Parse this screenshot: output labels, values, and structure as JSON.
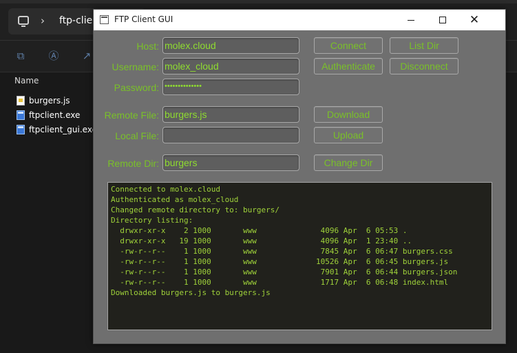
{
  "explorer": {
    "address_text": "ftp-clien",
    "column_name": "Name",
    "files": [
      {
        "name": "burgers.js",
        "type": "js"
      },
      {
        "name": "ftpclient.exe",
        "type": "exe"
      },
      {
        "name": "ftpclient_gui.exe",
        "type": "exe"
      }
    ]
  },
  "ftp_window": {
    "title": "FTP Client GUI",
    "host_label": "Host:",
    "host_value": "molex.cloud",
    "username_label": "Username:",
    "username_value": "molex_cloud",
    "password_label": "Password:",
    "password_value": "••••••••••••••",
    "remote_file_label": "Remote File:",
    "remote_file_value": "burgers.js",
    "local_file_label": "Local File:",
    "local_file_value": "",
    "remote_dir_label": "Remote Dir:",
    "remote_dir_value": "burgers",
    "buttons": {
      "connect": "Connect",
      "list_dir": "List Dir",
      "authenticate": "Authenticate",
      "disconnect": "Disconnect",
      "download": "Download",
      "upload": "Upload",
      "change_dir": "Change Dir"
    },
    "log_lines": [
      "Connected to molex.cloud",
      "Authenticated as molex_cloud",
      "Changed remote directory to: burgers/",
      "Directory listing:",
      "  drwxr-xr-x    2 1000       www              4096 Apr  6 05:53 .",
      "  drwxr-xr-x   19 1000       www              4096 Apr  1 23:40 ..",
      "  -rw-r--r--    1 1000       www              7845 Apr  6 06:47 burgers.css",
      "  -rw-r--r--    1 1000       www             10526 Apr  6 06:45 burgers.js",
      "  -rw-r--r--    1 1000       www              7901 Apr  6 06:44 burgers.json",
      "  -rw-r--r--    1 1000       www              1717 Apr  6 06:48 index.html",
      "Downloaded burgers.js to burgers.js"
    ]
  },
  "colors": {
    "label_green": "#7ac128",
    "log_green": "#9fd23a",
    "window_gray": "#6f6f6f",
    "log_background": "#21211c"
  }
}
